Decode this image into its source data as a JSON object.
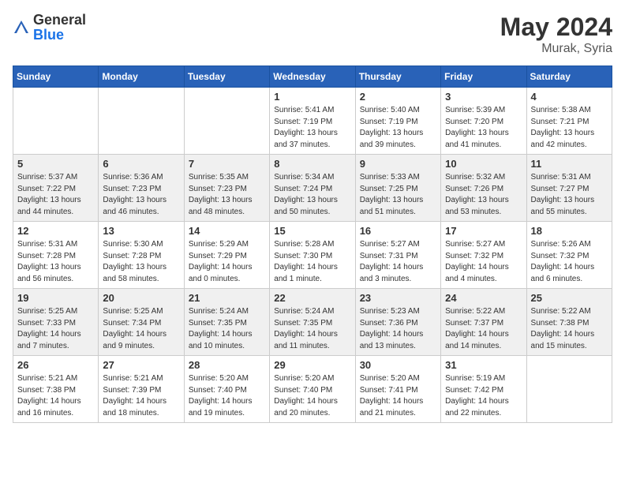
{
  "header": {
    "logo_general": "General",
    "logo_blue": "Blue",
    "month": "May 2024",
    "location": "Murak, Syria"
  },
  "weekdays": [
    "Sunday",
    "Monday",
    "Tuesday",
    "Wednesday",
    "Thursday",
    "Friday",
    "Saturday"
  ],
  "weeks": [
    [
      {
        "day": "",
        "sunrise": "",
        "sunset": "",
        "daylight": ""
      },
      {
        "day": "",
        "sunrise": "",
        "sunset": "",
        "daylight": ""
      },
      {
        "day": "",
        "sunrise": "",
        "sunset": "",
        "daylight": ""
      },
      {
        "day": "1",
        "sunrise": "Sunrise: 5:41 AM",
        "sunset": "Sunset: 7:19 PM",
        "daylight": "Daylight: 13 hours and 37 minutes."
      },
      {
        "day": "2",
        "sunrise": "Sunrise: 5:40 AM",
        "sunset": "Sunset: 7:19 PM",
        "daylight": "Daylight: 13 hours and 39 minutes."
      },
      {
        "day": "3",
        "sunrise": "Sunrise: 5:39 AM",
        "sunset": "Sunset: 7:20 PM",
        "daylight": "Daylight: 13 hours and 41 minutes."
      },
      {
        "day": "4",
        "sunrise": "Sunrise: 5:38 AM",
        "sunset": "Sunset: 7:21 PM",
        "daylight": "Daylight: 13 hours and 42 minutes."
      }
    ],
    [
      {
        "day": "5",
        "sunrise": "Sunrise: 5:37 AM",
        "sunset": "Sunset: 7:22 PM",
        "daylight": "Daylight: 13 hours and 44 minutes."
      },
      {
        "day": "6",
        "sunrise": "Sunrise: 5:36 AM",
        "sunset": "Sunset: 7:23 PM",
        "daylight": "Daylight: 13 hours and 46 minutes."
      },
      {
        "day": "7",
        "sunrise": "Sunrise: 5:35 AM",
        "sunset": "Sunset: 7:23 PM",
        "daylight": "Daylight: 13 hours and 48 minutes."
      },
      {
        "day": "8",
        "sunrise": "Sunrise: 5:34 AM",
        "sunset": "Sunset: 7:24 PM",
        "daylight": "Daylight: 13 hours and 50 minutes."
      },
      {
        "day": "9",
        "sunrise": "Sunrise: 5:33 AM",
        "sunset": "Sunset: 7:25 PM",
        "daylight": "Daylight: 13 hours and 51 minutes."
      },
      {
        "day": "10",
        "sunrise": "Sunrise: 5:32 AM",
        "sunset": "Sunset: 7:26 PM",
        "daylight": "Daylight: 13 hours and 53 minutes."
      },
      {
        "day": "11",
        "sunrise": "Sunrise: 5:31 AM",
        "sunset": "Sunset: 7:27 PM",
        "daylight": "Daylight: 13 hours and 55 minutes."
      }
    ],
    [
      {
        "day": "12",
        "sunrise": "Sunrise: 5:31 AM",
        "sunset": "Sunset: 7:28 PM",
        "daylight": "Daylight: 13 hours and 56 minutes."
      },
      {
        "day": "13",
        "sunrise": "Sunrise: 5:30 AM",
        "sunset": "Sunset: 7:28 PM",
        "daylight": "Daylight: 13 hours and 58 minutes."
      },
      {
        "day": "14",
        "sunrise": "Sunrise: 5:29 AM",
        "sunset": "Sunset: 7:29 PM",
        "daylight": "Daylight: 14 hours and 0 minutes."
      },
      {
        "day": "15",
        "sunrise": "Sunrise: 5:28 AM",
        "sunset": "Sunset: 7:30 PM",
        "daylight": "Daylight: 14 hours and 1 minute."
      },
      {
        "day": "16",
        "sunrise": "Sunrise: 5:27 AM",
        "sunset": "Sunset: 7:31 PM",
        "daylight": "Daylight: 14 hours and 3 minutes."
      },
      {
        "day": "17",
        "sunrise": "Sunrise: 5:27 AM",
        "sunset": "Sunset: 7:32 PM",
        "daylight": "Daylight: 14 hours and 4 minutes."
      },
      {
        "day": "18",
        "sunrise": "Sunrise: 5:26 AM",
        "sunset": "Sunset: 7:32 PM",
        "daylight": "Daylight: 14 hours and 6 minutes."
      }
    ],
    [
      {
        "day": "19",
        "sunrise": "Sunrise: 5:25 AM",
        "sunset": "Sunset: 7:33 PM",
        "daylight": "Daylight: 14 hours and 7 minutes."
      },
      {
        "day": "20",
        "sunrise": "Sunrise: 5:25 AM",
        "sunset": "Sunset: 7:34 PM",
        "daylight": "Daylight: 14 hours and 9 minutes."
      },
      {
        "day": "21",
        "sunrise": "Sunrise: 5:24 AM",
        "sunset": "Sunset: 7:35 PM",
        "daylight": "Daylight: 14 hours and 10 minutes."
      },
      {
        "day": "22",
        "sunrise": "Sunrise: 5:24 AM",
        "sunset": "Sunset: 7:35 PM",
        "daylight": "Daylight: 14 hours and 11 minutes."
      },
      {
        "day": "23",
        "sunrise": "Sunrise: 5:23 AM",
        "sunset": "Sunset: 7:36 PM",
        "daylight": "Daylight: 14 hours and 13 minutes."
      },
      {
        "day": "24",
        "sunrise": "Sunrise: 5:22 AM",
        "sunset": "Sunset: 7:37 PM",
        "daylight": "Daylight: 14 hours and 14 minutes."
      },
      {
        "day": "25",
        "sunrise": "Sunrise: 5:22 AM",
        "sunset": "Sunset: 7:38 PM",
        "daylight": "Daylight: 14 hours and 15 minutes."
      }
    ],
    [
      {
        "day": "26",
        "sunrise": "Sunrise: 5:21 AM",
        "sunset": "Sunset: 7:38 PM",
        "daylight": "Daylight: 14 hours and 16 minutes."
      },
      {
        "day": "27",
        "sunrise": "Sunrise: 5:21 AM",
        "sunset": "Sunset: 7:39 PM",
        "daylight": "Daylight: 14 hours and 18 minutes."
      },
      {
        "day": "28",
        "sunrise": "Sunrise: 5:20 AM",
        "sunset": "Sunset: 7:40 PM",
        "daylight": "Daylight: 14 hours and 19 minutes."
      },
      {
        "day": "29",
        "sunrise": "Sunrise: 5:20 AM",
        "sunset": "Sunset: 7:40 PM",
        "daylight": "Daylight: 14 hours and 20 minutes."
      },
      {
        "day": "30",
        "sunrise": "Sunrise: 5:20 AM",
        "sunset": "Sunset: 7:41 PM",
        "daylight": "Daylight: 14 hours and 21 minutes."
      },
      {
        "day": "31",
        "sunrise": "Sunrise: 5:19 AM",
        "sunset": "Sunset: 7:42 PM",
        "daylight": "Daylight: 14 hours and 22 minutes."
      },
      {
        "day": "",
        "sunrise": "",
        "sunset": "",
        "daylight": ""
      }
    ]
  ]
}
